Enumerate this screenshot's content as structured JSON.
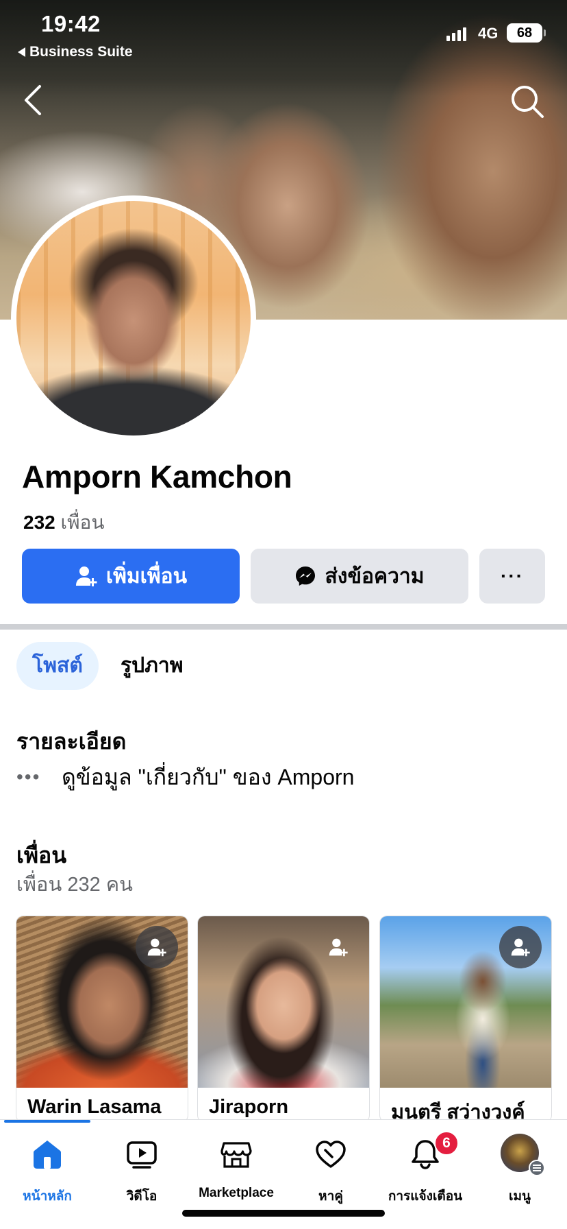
{
  "status_bar": {
    "time": "19:42",
    "back_app": "Business Suite",
    "network": "4G",
    "battery": "68"
  },
  "profile": {
    "name": "Amporn Kamchon",
    "friend_count": "232",
    "friend_word": "เพื่อน"
  },
  "actions": {
    "add_friend": "เพิ่มเพื่อน",
    "message": "ส่งข้อความ",
    "more": "···"
  },
  "tabs": [
    {
      "label": "โพสต์",
      "active": true
    },
    {
      "label": "รูปภาพ",
      "active": false
    }
  ],
  "details": {
    "heading": "รายละเอียด",
    "about_link": "ดูข้อมูล \"เกี่ยวกับ\" ของ Amporn",
    "dots": "•••"
  },
  "friends": {
    "heading": "เพื่อน",
    "subtitle": "เพื่อน 232 คน",
    "cards": [
      {
        "name": "Warin Lasama"
      },
      {
        "name": "Jiraporn"
      },
      {
        "name": "มนตรี สว่างวงค์"
      }
    ]
  },
  "bottom_nav": {
    "items": [
      {
        "label": "หน้าหลัก",
        "icon": "home-icon",
        "active": true
      },
      {
        "label": "วิดีโอ",
        "icon": "video-icon",
        "active": false
      },
      {
        "label": "Marketplace",
        "icon": "marketplace-icon",
        "active": false
      },
      {
        "label": "หาคู่",
        "icon": "dating-heart-icon",
        "active": false
      },
      {
        "label": "การแจ้งเตือน",
        "icon": "bell-icon",
        "active": false,
        "badge": "6"
      },
      {
        "label": "เมนู",
        "icon": "menu-avatar-icon",
        "active": false
      }
    ]
  },
  "colors": {
    "accent": "#1b74e4",
    "add_button": "#2b6ef2",
    "badge": "#e41e3f",
    "secondary_button": "#e4e6eb"
  }
}
